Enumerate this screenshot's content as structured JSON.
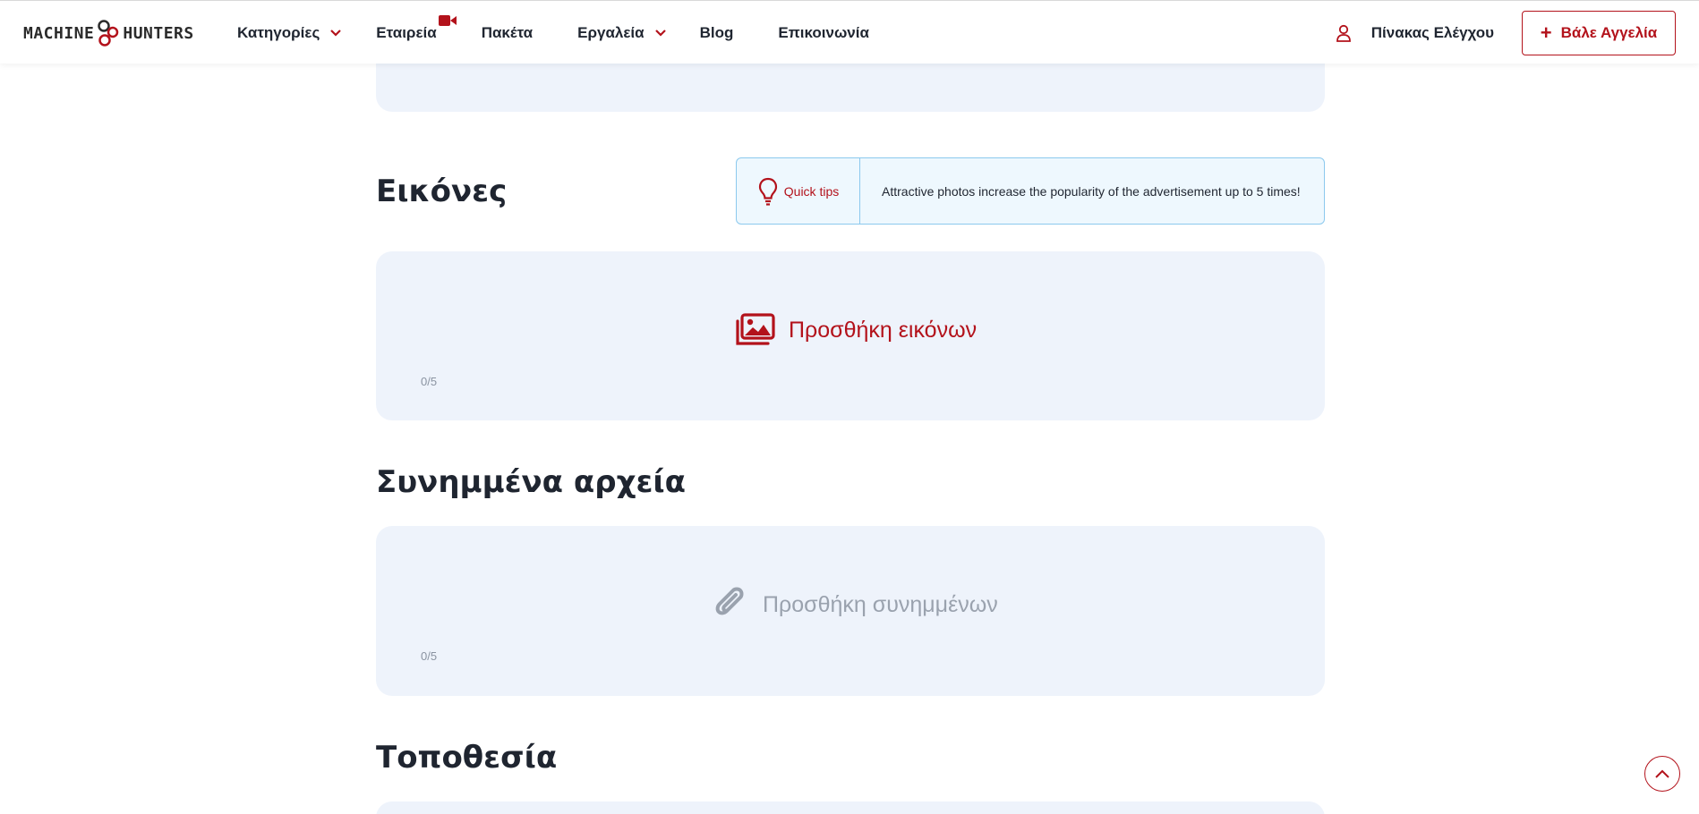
{
  "brand": {
    "logo_left": "MACHINE",
    "logo_right": "HUNTERS"
  },
  "nav": {
    "categories": "Κατηγορίες",
    "company": "Εταιρεία",
    "packages": "Πακέτα",
    "tools": "Εργαλεία",
    "blog": "Blog",
    "contact": "Επικοινωνία"
  },
  "header_right": {
    "dashboard": "Πίνακας Ελέγχου",
    "post_ad": "Βάλε Αγγελία",
    "post_ad_plus": "+"
  },
  "images_section": {
    "title": "Εικόνες",
    "tip_label": "Quick tips",
    "tip_text": "Attractive photos increase the popularity of the advertisement up to 5 times!",
    "add_label": "Προσθήκη εικόνων",
    "counter": "0/5"
  },
  "attachments_section": {
    "title": "Συνημμένα αρχεία",
    "add_label": "Προσθήκη συνημμένων",
    "counter": "0/5"
  },
  "location_section": {
    "title": "Τοποθεσία"
  },
  "colors": {
    "accent": "#b3121b",
    "panel_bg": "#eef3fb",
    "tip_border": "#8cc9ee",
    "muted": "#9aa2ae"
  },
  "icons": [
    "user-icon",
    "chevron-down-icon",
    "video-icon",
    "lightbulb-icon",
    "images-icon",
    "paperclip-icon",
    "chevron-up-icon"
  ]
}
